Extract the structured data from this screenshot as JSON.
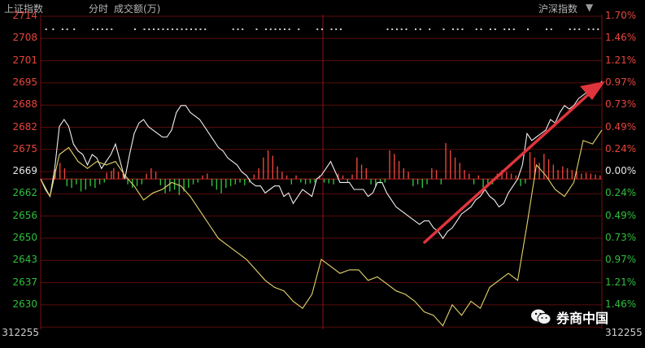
{
  "header": {
    "index_name": "上证指数",
    "period": "分时",
    "volume_label": "成交额(万)",
    "right_index": "沪深指数"
  },
  "watermark": {
    "text": "券商中国",
    "icon": "wechat-icon"
  },
  "colors": {
    "up": "#e8453c",
    "down": "#2fbf3c",
    "neutral": "#e6e6e6",
    "index_line": "#f0f0f0",
    "avg_line": "#e3d36a",
    "grid": "#5a0d0d",
    "arrow": "#e0343c"
  },
  "chart_data": {
    "type": "line",
    "y_ticks_left": [
      "2714",
      "2708",
      "2701",
      "2695",
      "2688",
      "2682",
      "2675",
      "2669",
      "2662",
      "2656",
      "2650",
      "2643",
      "2637",
      "2630"
    ],
    "y_ticks_right": [
      "1.70%",
      "1.46%",
      "1.21%",
      "0.97%",
      "0.73%",
      "0.49%",
      "0.24%",
      "0.00%",
      "0.24%",
      "0.49%",
      "0.73%",
      "0.97%",
      "1.21%",
      "1.46%"
    ],
    "volume_label": "312255",
    "volume_label_right": "312255",
    "baseline": 2669,
    "ylim": [
      2626,
      2716
    ],
    "series": [
      {
        "x": [
          0,
          2,
          4,
          6,
          8,
          10,
          12,
          14,
          16,
          18,
          20,
          22,
          24,
          26,
          28,
          30,
          32,
          34,
          36,
          38,
          40,
          42,
          44,
          46,
          48,
          50,
          52,
          54,
          56,
          58,
          60,
          62,
          64,
          66,
          68,
          70,
          72,
          74,
          76,
          78,
          80,
          82,
          84,
          86,
          88,
          90,
          92,
          94,
          96,
          98,
          100,
          102,
          104,
          106,
          108,
          110,
          112,
          114,
          116,
          118,
          120,
          122,
          124,
          126,
          128,
          130,
          132,
          134,
          136,
          138,
          140,
          142,
          144,
          146,
          148,
          150,
          152,
          154,
          156,
          158,
          160,
          162,
          164,
          166,
          168,
          170,
          172,
          174,
          176,
          178,
          180,
          182,
          184,
          186,
          188,
          190,
          192,
          194,
          196,
          198,
          200,
          202,
          204,
          206,
          208,
          210,
          212,
          214,
          216,
          218,
          220,
          222,
          224,
          226,
          228,
          230,
          232,
          234,
          236,
          238,
          240
        ],
        "y": [
          2669,
          2666,
          2664,
          2672,
          2684,
          2686,
          2684,
          2679,
          2677,
          2676,
          2673,
          2676,
          2675,
          2672,
          2674,
          2676,
          2679,
          2674,
          2669,
          2676,
          2682,
          2685,
          2686,
          2684,
          2683,
          2682,
          2681,
          2681,
          2683,
          2688,
          2690,
          2690,
          2688,
          2687,
          2686,
          2684,
          2682,
          2680,
          2678,
          2677,
          2675,
          2674,
          2673,
          2671,
          2670,
          2668,
          2667,
          2667,
          2665,
          2666,
          2667,
          2667,
          2664,
          2665,
          2662,
          2664,
          2666,
          2665,
          2664,
          2669,
          2670,
          2672,
          2674,
          2671,
          2668,
          2668,
          2668,
          2666,
          2666,
          2666,
          2664,
          2665,
          2668,
          2668,
          2665,
          2663,
          2661,
          2660,
          2659,
          2658,
          2657,
          2656,
          2657,
          2657,
          2655,
          2654,
          2652,
          2654,
          2655,
          2657,
          2659,
          2660,
          2661,
          2663,
          2664,
          2666,
          2664,
          2663,
          2661,
          2662,
          2665,
          2667,
          2669,
          2673,
          2682,
          2680,
          2681,
          2682,
          2683,
          2686,
          2685,
          2688,
          2690,
          2689,
          2690,
          2692,
          2693,
          2694,
          2693,
          2695,
          2697
        ]
      },
      {
        "x": [
          0,
          4,
          8,
          12,
          16,
          20,
          24,
          28,
          32,
          36,
          40,
          44,
          48,
          52,
          56,
          60,
          64,
          68,
          72,
          76,
          80,
          84,
          88,
          92,
          96,
          100,
          104,
          108,
          112,
          116,
          120,
          124,
          128,
          132,
          136,
          140,
          144,
          148,
          152,
          156,
          160,
          164,
          168,
          172,
          176,
          180,
          184,
          188,
          192,
          196,
          200,
          204,
          208,
          212,
          216,
          220,
          224,
          228,
          232,
          236,
          240
        ],
        "y": [
          2669,
          2664,
          2676,
          2678,
          2674,
          2672,
          2674,
          2673,
          2674,
          2670,
          2667,
          2663,
          2665,
          2666,
          2668,
          2667,
          2664,
          2660,
          2656,
          2652,
          2650,
          2648,
          2646,
          2643,
          2640,
          2638,
          2637,
          2634,
          2632,
          2636,
          2646,
          2644,
          2642,
          2643,
          2643,
          2640,
          2641,
          2639,
          2637,
          2636,
          2634,
          2631,
          2630,
          2627,
          2633,
          2630,
          2634,
          2632,
          2638,
          2640,
          2642,
          2640,
          2656,
          2673,
          2670,
          2666,
          2664,
          2668,
          2680,
          2679,
          2683
        ]
      }
    ],
    "volume": [
      {
        "x": 6,
        "v": 0.55
      },
      {
        "x": 8,
        "v": 0.9
      },
      {
        "x": 10,
        "v": 0.6
      },
      {
        "x": 11,
        "v": -0.4
      },
      {
        "x": 13,
        "v": -0.5
      },
      {
        "x": 15,
        "v": -0.3
      },
      {
        "x": 17,
        "v": -0.7
      },
      {
        "x": 19,
        "v": -0.6
      },
      {
        "x": 21,
        "v": -0.4
      },
      {
        "x": 23,
        "v": -0.5
      },
      {
        "x": 25,
        "v": -0.3
      },
      {
        "x": 27,
        "v": -0.2
      },
      {
        "x": 28,
        "v": 0.35
      },
      {
        "x": 30,
        "v": 0.45
      },
      {
        "x": 31,
        "v": 0.6
      },
      {
        "x": 33,
        "v": 0.4
      },
      {
        "x": 35,
        "v": 0.3
      },
      {
        "x": 37,
        "v": -0.3
      },
      {
        "x": 39,
        "v": -0.5
      },
      {
        "x": 41,
        "v": -0.4
      },
      {
        "x": 43,
        "v": -0.3
      },
      {
        "x": 45,
        "v": 0.3
      },
      {
        "x": 47,
        "v": 0.6
      },
      {
        "x": 49,
        "v": 0.4
      },
      {
        "x": 51,
        "v": -0.35
      },
      {
        "x": 53,
        "v": -0.8
      },
      {
        "x": 55,
        "v": -0.7
      },
      {
        "x": 57,
        "v": -0.6
      },
      {
        "x": 59,
        "v": -0.9
      },
      {
        "x": 61,
        "v": -0.7
      },
      {
        "x": 63,
        "v": -0.5
      },
      {
        "x": 65,
        "v": -0.3
      },
      {
        "x": 67,
        "v": -0.2
      },
      {
        "x": 69,
        "v": 0.2
      },
      {
        "x": 71,
        "v": 0.3
      },
      {
        "x": 73,
        "v": -0.4
      },
      {
        "x": 75,
        "v": -0.6
      },
      {
        "x": 77,
        "v": -0.8
      },
      {
        "x": 79,
        "v": -0.5
      },
      {
        "x": 81,
        "v": -0.4
      },
      {
        "x": 83,
        "v": -0.3
      },
      {
        "x": 85,
        "v": -0.2
      },
      {
        "x": 87,
        "v": -0.35
      },
      {
        "x": 89,
        "v": -0.2
      },
      {
        "x": 91,
        "v": 0.25
      },
      {
        "x": 93,
        "v": 0.6
      },
      {
        "x": 95,
        "v": 1.2
      },
      {
        "x": 97,
        "v": 1.6
      },
      {
        "x": 99,
        "v": 1.3
      },
      {
        "x": 101,
        "v": 0.7
      },
      {
        "x": 103,
        "v": 0.4
      },
      {
        "x": 105,
        "v": 0.2
      },
      {
        "x": 107,
        "v": -0.3
      },
      {
        "x": 109,
        "v": 0.2
      },
      {
        "x": 111,
        "v": -0.2
      },
      {
        "x": 113,
        "v": -0.3
      },
      {
        "x": 115,
        "v": -0.25
      },
      {
        "x": 117,
        "v": -0.2
      },
      {
        "x": 119,
        "v": 0.2
      },
      {
        "x": 121,
        "v": -0.2
      },
      {
        "x": 123,
        "v": -0.25
      },
      {
        "x": 125,
        "v": -0.3
      },
      {
        "x": 127,
        "v": 0.3
      },
      {
        "x": 129,
        "v": 0.2
      },
      {
        "x": 131,
        "v": -0.2
      },
      {
        "x": 133,
        "v": 0.25
      },
      {
        "x": 135,
        "v": 1.2
      },
      {
        "x": 137,
        "v": 0.8
      },
      {
        "x": 139,
        "v": 0.6
      },
      {
        "x": 141,
        "v": -0.3
      },
      {
        "x": 143,
        "v": -0.4
      },
      {
        "x": 145,
        "v": -0.25
      },
      {
        "x": 147,
        "v": -0.2
      },
      {
        "x": 149,
        "v": 1.6
      },
      {
        "x": 151,
        "v": 1.4
      },
      {
        "x": 153,
        "v": 1.0
      },
      {
        "x": 155,
        "v": 0.6
      },
      {
        "x": 157,
        "v": 0.4
      },
      {
        "x": 159,
        "v": -0.4
      },
      {
        "x": 161,
        "v": -0.3
      },
      {
        "x": 163,
        "v": -0.5
      },
      {
        "x": 165,
        "v": -0.3
      },
      {
        "x": 167,
        "v": 0.6
      },
      {
        "x": 169,
        "v": 0.5
      },
      {
        "x": 171,
        "v": -0.3
      },
      {
        "x": 173,
        "v": 2.0
      },
      {
        "x": 175,
        "v": 1.6
      },
      {
        "x": 177,
        "v": 1.2
      },
      {
        "x": 179,
        "v": 0.9
      },
      {
        "x": 181,
        "v": 0.5
      },
      {
        "x": 183,
        "v": 0.3
      },
      {
        "x": 185,
        "v": -0.3
      },
      {
        "x": 187,
        "v": 0.2
      },
      {
        "x": 189,
        "v": -0.5
      },
      {
        "x": 191,
        "v": -0.35
      },
      {
        "x": 193,
        "v": -0.3
      },
      {
        "x": 195,
        "v": 0.3
      },
      {
        "x": 197,
        "v": 0.5
      },
      {
        "x": 199,
        "v": 0.4
      },
      {
        "x": 201,
        "v": 0.3
      },
      {
        "x": 203,
        "v": 0.2
      },
      {
        "x": 205,
        "v": -0.4
      },
      {
        "x": 207,
        "v": -0.25
      },
      {
        "x": 209,
        "v": 1.5
      },
      {
        "x": 211,
        "v": 1.2
      },
      {
        "x": 213,
        "v": 0.9
      },
      {
        "x": 215,
        "v": 1.4
      },
      {
        "x": 217,
        "v": 1.1
      },
      {
        "x": 219,
        "v": 0.8
      },
      {
        "x": 221,
        "v": 0.5
      },
      {
        "x": 223,
        "v": 0.7
      },
      {
        "x": 225,
        "v": 0.6
      },
      {
        "x": 227,
        "v": 0.5
      },
      {
        "x": 229,
        "v": 0.4
      },
      {
        "x": 231,
        "v": 0.3
      },
      {
        "x": 233,
        "v": 0.35
      },
      {
        "x": 235,
        "v": 0.3
      },
      {
        "x": 237,
        "v": 0.25
      },
      {
        "x": 239,
        "v": 0.2
      }
    ],
    "dots": [
      2,
      5,
      9,
      11,
      14,
      22,
      24,
      26,
      28,
      30,
      40,
      44,
      46,
      48,
      50,
      52,
      54,
      56,
      58,
      60,
      62,
      64,
      66,
      68,
      70,
      82,
      84,
      86,
      92,
      96,
      98,
      100,
      102,
      104,
      106,
      110,
      118,
      120,
      124,
      126,
      128,
      148,
      150,
      152,
      154,
      156,
      160,
      162,
      166,
      172,
      176,
      178,
      180,
      186,
      188,
      192,
      194,
      198,
      200,
      202,
      208,
      216,
      218,
      226,
      228,
      230,
      234,
      236,
      238
    ],
    "grid": true
  }
}
